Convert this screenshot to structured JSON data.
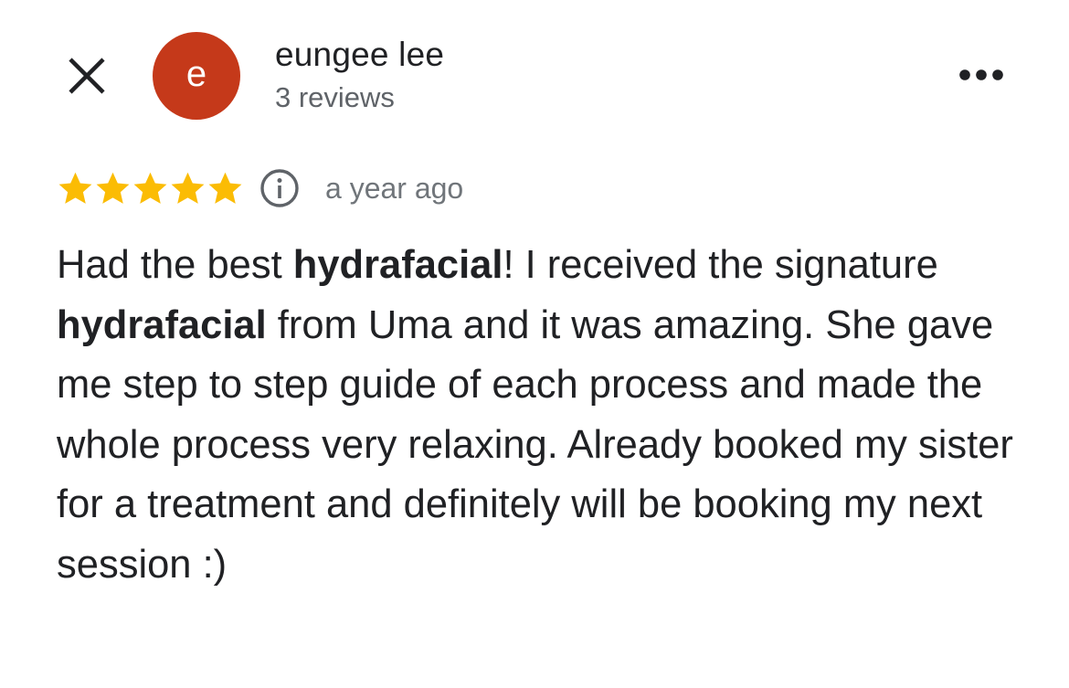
{
  "header": {
    "close_icon": "close-icon",
    "avatar_letter": "e",
    "avatar_color": "#c5391a",
    "reviewer_name": "eungee lee",
    "review_count": "3 reviews",
    "more_icon": "more-horizontal-icon"
  },
  "review": {
    "rating": 5,
    "max_rating": 5,
    "star_color": "#fbbc04",
    "info_icon": "info-icon",
    "time_ago": "a year ago",
    "segments": [
      {
        "text": "Had the best ",
        "bold": false
      },
      {
        "text": "hydrafacial",
        "bold": true
      },
      {
        "text": "! I received the signature ",
        "bold": false
      },
      {
        "text": "hydrafacial",
        "bold": true
      },
      {
        "text": " from Uma and it was amazing. She gave me step to step guide of each process and made the whole process very relaxing. Already booked my sister for a treatment and definitely will be booking my next session :)",
        "bold": false
      }
    ]
  }
}
